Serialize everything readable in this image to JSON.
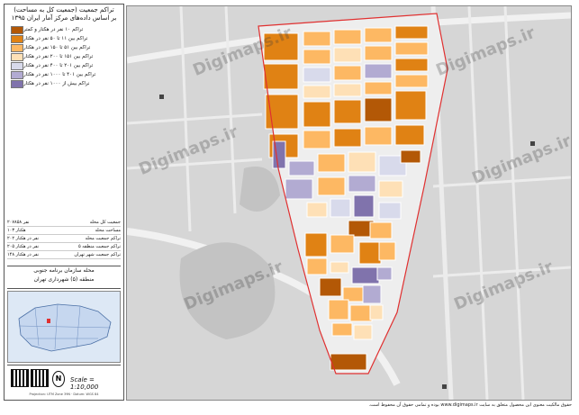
{
  "panel": {
    "title": "تراکم جمعیت (جمعیت کل به مساحت)",
    "subtitle": "بر اساس داده‌های مرکز آمار ایران ۱۳۹۵"
  },
  "legend": [
    {
      "label": "تراکم ۱۰ نفر در هکتار و کمتر",
      "color": "#b35806"
    },
    {
      "label": "تراکم بین ۱۱ تا ۵۰ نفر در هکتار",
      "color": "#e08214"
    },
    {
      "label": "تراکم بین ۵۱ تا ۱۵۰ نفر در هکتار",
      "color": "#fdb863"
    },
    {
      "label": "تراکم بین ۱۵۱ تا ۲۰۰ نفر در هکتار",
      "color": "#fee0b6"
    },
    {
      "label": "تراکم بین ۲۰۱ تا ۴۰۰ نفر در هکتار",
      "color": "#d8daeb"
    },
    {
      "label": "تراکم بین ۴۰۱ تا ۱۰۰۰ نفر در هکتار",
      "color": "#b2abd2"
    },
    {
      "label": "تراکم بیش از ۱۰۰۰ نفر در هکتار",
      "color": "#8073ac"
    }
  ],
  "stats": [
    {
      "label": "جمعیت کل محله",
      "value": "۲۰۷۸۵۸ نفر"
    },
    {
      "label": "مساحت محله",
      "value": "۱۰۳ هکتار"
    },
    {
      "label": "تراکم جمعیت محله",
      "value": "۲۰۲ نفر در هکتار"
    },
    {
      "label": "تراکم جمعیت منطقه ۵",
      "value": "۲۰۵ نفر در هکتار"
    },
    {
      "label": "تراکم جمعیت شهر تهران",
      "value": "۱۴۸ نفر در هکتار"
    }
  ],
  "area": {
    "line1": "محله سازمان برنامه جنوبی",
    "line2": "منطقه (۵) شهرداری تهران"
  },
  "scale_text": "Scale = 1:10,000",
  "north_label": "N",
  "fine_print": "Projection: UTM Zone 39N · Datum: WGS 84",
  "watermark": "Digimaps.ir",
  "footer": "حقوق مالکیت معنوی این محصول متعلق به سایت www.digimaps.ir بوده و تمامی حقوق آن محفوظ است.",
  "colors": {
    "c1": "#b35806",
    "c2": "#e08214",
    "c3": "#fdb863",
    "c4": "#fee0b6",
    "c5": "#d8daeb",
    "c6": "#b2abd2",
    "c7": "#8073ac",
    "boundary": "#e03030",
    "street": "#f4f4f4",
    "bg": "#d6d6d6",
    "park": "#bdbdbd"
  }
}
